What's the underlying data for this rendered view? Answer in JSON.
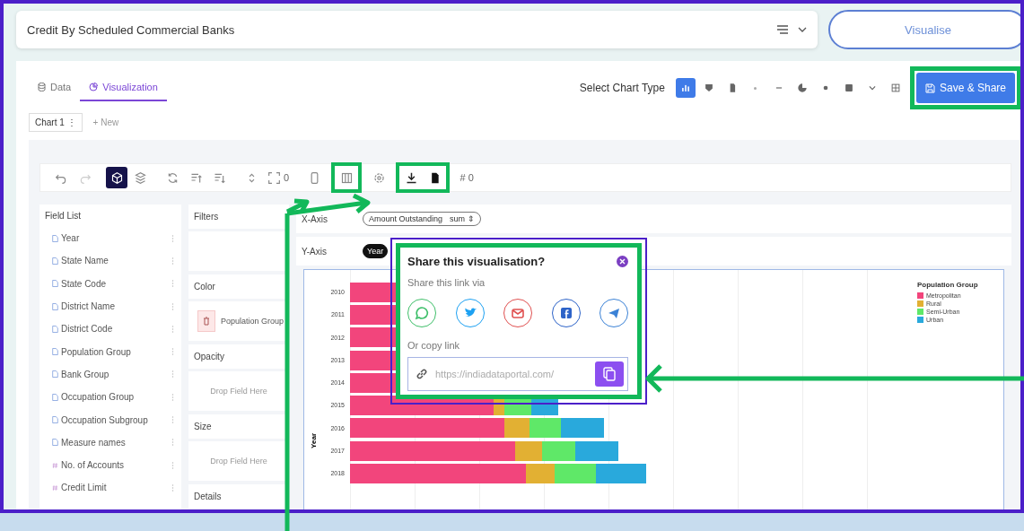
{
  "header": {
    "title": "Credit By Scheduled Commercial Banks",
    "visualise_button": "Visualise"
  },
  "tabs": [
    {
      "label": "Data",
      "kind": "data",
      "selected": false
    },
    {
      "label": "Visualization",
      "kind": "visualization",
      "selected": true
    }
  ],
  "chart_type": {
    "label": "Select Chart Type",
    "types": [
      {
        "kind": "bar",
        "selected": true
      },
      {
        "kind": "shield",
        "selected": false
      },
      {
        "kind": "page",
        "selected": false
      },
      {
        "kind": "dot",
        "selected": false
      },
      {
        "kind": "dash",
        "selected": false
      },
      {
        "kind": "pie",
        "selected": false
      },
      {
        "kind": "circle",
        "selected": false
      },
      {
        "kind": "square",
        "selected": false
      },
      {
        "kind": "chevron",
        "selected": false
      },
      {
        "kind": "grid",
        "selected": false
      }
    ]
  },
  "save_button": {
    "label": "Save & Share",
    "highlighted": true
  },
  "chart_tabs": [
    {
      "label": "Chart 1",
      "menu": "⋮"
    }
  ],
  "new_chart": "+ New",
  "toolbar": [
    {
      "highlighted": false,
      "buttons": [
        {
          "kind": "undo",
          "selected": false
        },
        {
          "kind": "redo",
          "selected": false
        }
      ]
    },
    {
      "highlighted": false,
      "buttons": [
        {
          "kind": "cube",
          "selected": true
        },
        {
          "kind": "layers",
          "selected": false
        }
      ]
    },
    {
      "highlighted": false,
      "buttons": [
        {
          "kind": "refresh",
          "selected": false
        },
        {
          "kind": "sort-up",
          "selected": false
        },
        {
          "kind": "sort-down",
          "selected": false
        }
      ]
    },
    {
      "highlighted": false,
      "buttons": [
        {
          "kind": "updown",
          "selected": false
        },
        {
          "kind": "expand",
          "selected": false,
          "count": "0"
        }
      ]
    },
    {
      "highlighted": false,
      "buttons": [
        {
          "kind": "device",
          "selected": false
        }
      ]
    },
    {
      "highlighted": true,
      "buttons": [
        {
          "kind": "columns",
          "selected": false
        }
      ]
    },
    {
      "highlighted": false,
      "buttons": [
        {
          "kind": "gear",
          "selected": false
        }
      ]
    },
    {
      "highlighted": true,
      "buttons": [
        {
          "kind": "download",
          "selected": false
        },
        {
          "kind": "file",
          "selected": false
        }
      ]
    },
    {
      "highlighted": false,
      "buttons": [
        {
          "kind": "hash",
          "selected": false,
          "label": "#",
          "count": "0"
        }
      ]
    }
  ],
  "field_list": {
    "title": "Field List",
    "fields": [
      {
        "label": "Year",
        "kind": "dimension"
      },
      {
        "label": "State Name",
        "kind": "dimension"
      },
      {
        "label": "State Code",
        "kind": "dimension"
      },
      {
        "label": "District Name",
        "kind": "dimension"
      },
      {
        "label": "District Code",
        "kind": "dimension"
      },
      {
        "label": "Population Group",
        "kind": "dimension"
      },
      {
        "label": "Bank Group",
        "kind": "dimension"
      },
      {
        "label": "Occupation Group",
        "kind": "dimension"
      },
      {
        "label": "Occupation Subgroup",
        "kind": "dimension"
      },
      {
        "label": "Measure names",
        "kind": "dimension"
      },
      {
        "label": "No. of Accounts",
        "kind": "measure"
      },
      {
        "label": "Credit Limit",
        "kind": "measure"
      }
    ]
  },
  "shelves": [
    {
      "label": "Filters",
      "kind": "empty"
    },
    {
      "label": "Color",
      "kind": "pill",
      "pill": "Population Group"
    },
    {
      "label": "Opacity",
      "kind": "drop",
      "hint": "Drop Field Here"
    },
    {
      "label": "Size",
      "kind": "drop",
      "hint": "Drop Field Here"
    },
    {
      "label": "Details",
      "kind": "empty"
    }
  ],
  "axes": [
    {
      "label": "X-Axis",
      "pill": "Amount Outstanding",
      "aggregate": "sum",
      "toggle": "⇕",
      "kind": "measure"
    },
    {
      "label": "Y-Axis",
      "pill": "Year",
      "kind": "dimension"
    }
  ],
  "chart": {
    "y_title": "Year",
    "y_labels": [
      "2010",
      "2011",
      "2012",
      "2013",
      "2014",
      "2015",
      "2016",
      "2017",
      "2018"
    ],
    "legend_title": "Population Group",
    "legend": [
      {
        "label": "Metropolitan",
        "color": "#f2457c"
      },
      {
        "label": "Rural",
        "color": "#e2b033"
      },
      {
        "label": "Semi-Urban",
        "color": "#5fe868"
      },
      {
        "label": "Urban",
        "color": "#29a9dc"
      }
    ]
  },
  "share_popup": {
    "title": "Share this visualisation?",
    "via": "Share this link via",
    "channels": [
      {
        "kind": "chat",
        "color": "#3fbf6a"
      },
      {
        "kind": "bird",
        "color": "#1da1f2"
      },
      {
        "kind": "mail",
        "color": "#e05050"
      },
      {
        "kind": "f",
        "color": "#2d63c8"
      },
      {
        "kind": "plane",
        "color": "#3b82d6"
      }
    ],
    "copy_label": "Or copy link",
    "link": "https://indiadataportal.com/"
  }
}
